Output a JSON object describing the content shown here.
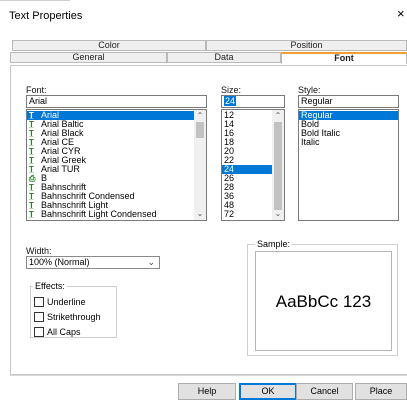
{
  "window": {
    "title": "Text Properties",
    "close_glyph": "×"
  },
  "tabs": {
    "row1": [
      {
        "label": "Color"
      },
      {
        "label": "Position"
      }
    ],
    "row2": [
      {
        "label": "General"
      },
      {
        "label": "Data"
      },
      {
        "label": "Font",
        "active": true
      }
    ]
  },
  "font": {
    "label": "Font:",
    "value": "Arial",
    "items": [
      {
        "label": "Arial",
        "icon": "truetype-font-icon",
        "selected": true
      },
      {
        "label": "Arial Baltic",
        "icon": "truetype-font-icon"
      },
      {
        "label": "Arial Black",
        "icon": "truetype-font-icon"
      },
      {
        "label": "Arial CE",
        "icon": "truetype-font-icon"
      },
      {
        "label": "Arial CYR",
        "icon": "truetype-font-icon"
      },
      {
        "label": "Arial Greek",
        "icon": "truetype-font-icon"
      },
      {
        "label": "Arial TUR",
        "icon": "truetype-font-icon"
      },
      {
        "label": "B",
        "icon": "printer-font-icon"
      },
      {
        "label": "Bahnschrift",
        "icon": "truetype-font-icon"
      },
      {
        "label": "Bahnschrift Condensed",
        "icon": "truetype-font-icon"
      },
      {
        "label": "Bahnschrift Light",
        "icon": "truetype-font-icon"
      },
      {
        "label": "Bahnschrift Light Condensed",
        "icon": "truetype-font-icon"
      }
    ]
  },
  "size": {
    "label": "Size:",
    "value": "24",
    "items": [
      {
        "label": "12"
      },
      {
        "label": "14"
      },
      {
        "label": "16"
      },
      {
        "label": "18"
      },
      {
        "label": "20"
      },
      {
        "label": "22"
      },
      {
        "label": "24",
        "selected": true
      },
      {
        "label": "26"
      },
      {
        "label": "28"
      },
      {
        "label": "36"
      },
      {
        "label": "48"
      },
      {
        "label": "72"
      }
    ]
  },
  "style": {
    "label": "Style:",
    "value": "Regular",
    "items": [
      {
        "label": "Regular",
        "selected": true
      },
      {
        "label": "Bold"
      },
      {
        "label": "Bold Italic"
      },
      {
        "label": "Italic"
      }
    ]
  },
  "width": {
    "label": "Width:",
    "value": "100% (Normal)"
  },
  "effects": {
    "label": "Effects:",
    "items": [
      {
        "label": "Underline",
        "checked": false
      },
      {
        "label": "Strikethrough",
        "checked": false
      },
      {
        "label": "All Caps",
        "checked": false
      }
    ]
  },
  "sample": {
    "label": "Sample:",
    "text": "AaBbCc 123"
  },
  "buttons": {
    "help": "Help",
    "ok": "OK",
    "cancel": "Cancel",
    "place": "Place"
  },
  "colors": {
    "accent": "#0078d7",
    "active_tab": "#f1a12e"
  }
}
